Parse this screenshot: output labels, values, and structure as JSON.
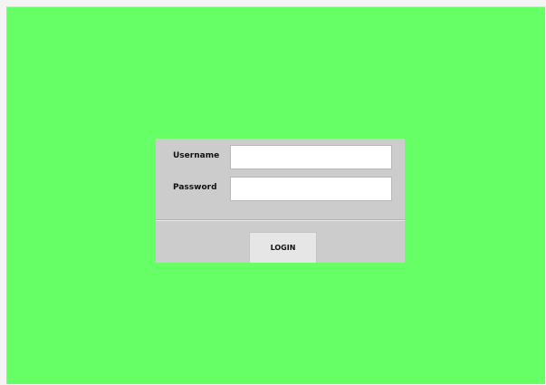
{
  "colors": {
    "background": "#66ff66",
    "panel": "#cccccc",
    "input": "#ffffff",
    "button": "#e6e6e6"
  },
  "login_form": {
    "username_label": "Username",
    "username_value": "",
    "password_label": "Password",
    "password_value": "",
    "login_label": "LOGIN"
  }
}
